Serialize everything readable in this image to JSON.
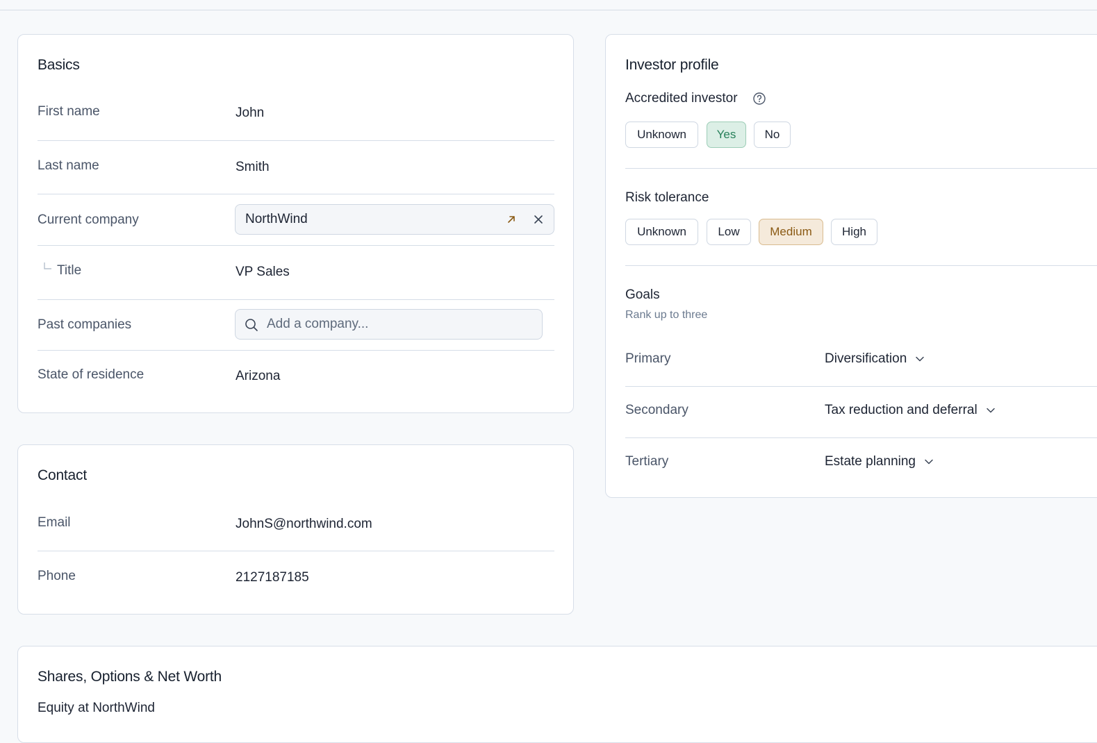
{
  "basics": {
    "title": "Basics",
    "first_name": {
      "label": "First name",
      "value": "John"
    },
    "last_name": {
      "label": "Last name",
      "value": "Smith"
    },
    "current_company": {
      "label": "Current company",
      "value": "NorthWind"
    },
    "title_field": {
      "label": "Title",
      "value": "VP Sales"
    },
    "past_companies": {
      "label": "Past companies",
      "placeholder": "Add a company..."
    },
    "state": {
      "label": "State of residence",
      "value": "Arizona"
    }
  },
  "contact": {
    "title": "Contact",
    "email": {
      "label": "Email",
      "value": "JohnS@northwind.com"
    },
    "phone": {
      "label": "Phone",
      "value": "2127187185"
    }
  },
  "investor_profile": {
    "title": "Investor profile",
    "accredited": {
      "label": "Accredited investor",
      "options": [
        "Unknown",
        "Yes",
        "No"
      ],
      "selected": "Yes"
    },
    "risk": {
      "label": "Risk tolerance",
      "options": [
        "Unknown",
        "Low",
        "Medium",
        "High"
      ],
      "selected": "Medium"
    },
    "goals": {
      "label": "Goals",
      "hint": "Rank up to three",
      "rows": [
        {
          "label": "Primary",
          "value": "Diversification"
        },
        {
          "label": "Secondary",
          "value": "Tax reduction and deferral"
        },
        {
          "label": "Tertiary",
          "value": "Estate planning"
        }
      ]
    }
  },
  "shares": {
    "title": "Shares, Options & Net Worth",
    "equity_label": "Equity at NorthWind"
  },
  "colors": {
    "selected_green_bg": "#dcefe6",
    "selected_green_text": "#27805a",
    "selected_amber_bg": "#f5eadb",
    "selected_amber_text": "#8a5a14",
    "link_arrow": "#8a5a14"
  },
  "icons": [
    "help-circle-icon",
    "external-link-arrow-icon",
    "close-icon",
    "search-icon",
    "chevron-down-icon",
    "tree-branch-icon"
  ]
}
